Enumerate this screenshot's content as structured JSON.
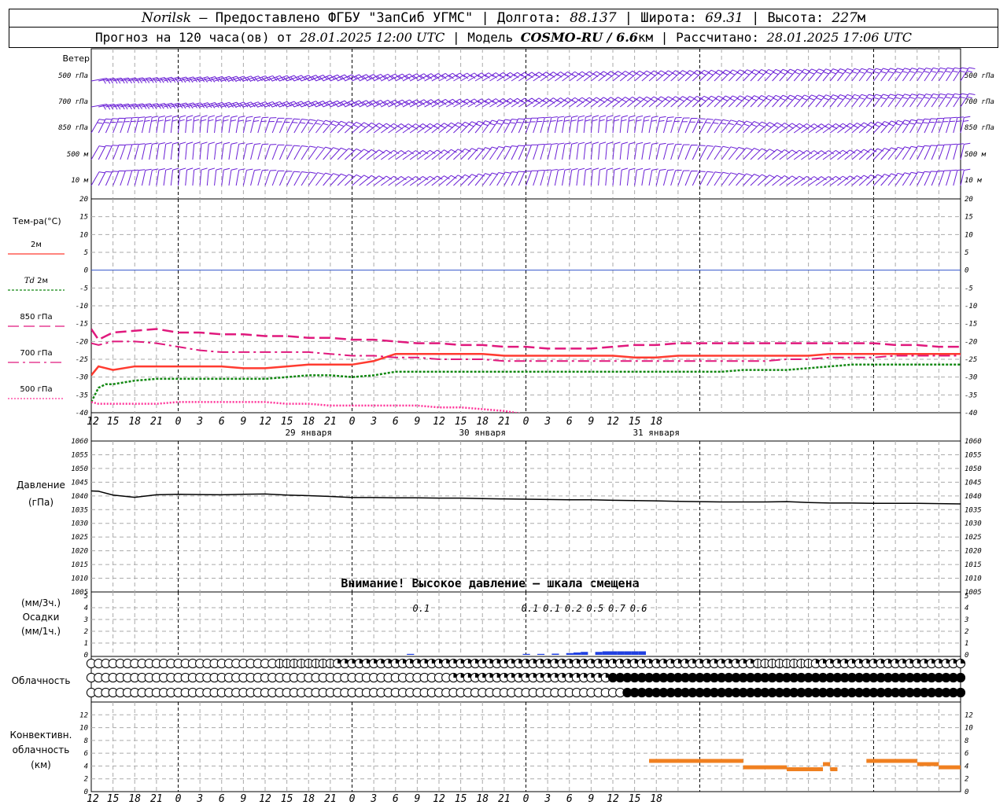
{
  "header": {
    "station": "Norilsk",
    "dash": " – ",
    "provided": "Предоставлено ФГБУ \"ЗапСиб УГМС\" | Долгота: ",
    "lon": "88.137",
    "sep1": " | Широта: ",
    "lat": "69.31",
    "sep2": " | Высота: ",
    "alt": "227",
    "alt_unit": "м",
    "forecast_prefix": "Прогноз на 120 часа(ов) от ",
    "issued": "28.01.2025 12:00 UTC",
    "model_prefix": "  | Модель ",
    "model": "COSMO-RU / 6.6",
    "model_unit": "км",
    "calc_prefix": " | Рассчитано: ",
    "calculated": "28.01.2025 17:06 UTC"
  },
  "labels": {
    "wind": "Ветер",
    "temp": "Тем-ра(°С)",
    "t2m": "2м",
    "td_italic": "Td",
    "td_rest": " 2м",
    "t850": "850 гПа",
    "t700": "700 гПа",
    "t500": "500 гПа",
    "pressure": "Давление",
    "pressure_unit": "(гПа)",
    "precip_unit1": "(мм/3ч.)",
    "precip_title": "Осадки",
    "precip_unit2": "(мм/1ч.)",
    "cloud": "Облачность",
    "conv1": "Конвективн.",
    "conv2": "облачность",
    "conv3": "(км)",
    "warning": "Внимание! Высокое давление – шкала смещена"
  },
  "colors": {
    "t2m": "#ff3b30",
    "td2m": "#118811",
    "t850": "#e0197d",
    "t700": "#e0197d",
    "t500": "#ff3399",
    "wind": "#6a1fd6",
    "pressure": "#000000",
    "precip": "#2040e0",
    "conv": "#f08020",
    "zero": "#3355cc",
    "grid": "#999999"
  },
  "chart_data": [
    {
      "type": "barbs",
      "levels": [
        "500 гПа",
        "700 гПа",
        "850 гПа",
        "500 м",
        "10 м"
      ],
      "note": "wind barbs per level, hourly"
    },
    {
      "type": "line",
      "ylim": [
        -40,
        20
      ],
      "yticks": [
        20,
        15,
        10,
        5,
        0,
        -5,
        -10,
        -15,
        -20,
        -25,
        -30,
        -35,
        -40
      ],
      "x_hours": [
        0,
        1,
        2,
        3,
        6,
        9,
        12,
        15,
        18,
        21,
        24,
        27,
        30,
        33,
        36,
        39,
        42,
        45,
        48,
        51,
        54,
        57,
        60,
        63,
        66,
        69,
        72,
        75,
        78,
        81,
        84,
        87,
        90,
        93,
        96,
        99,
        102,
        105,
        108,
        111,
        114,
        117,
        120
      ],
      "series": [
        {
          "name": "2м",
          "values": [
            -29.5,
            -27,
            -27.5,
            -28,
            -27,
            -27,
            -27,
            -27,
            -27,
            -27.5,
            -27.5,
            -27,
            -26.5,
            -26.5,
            -26.5,
            -25.5,
            -23.5,
            -23.5,
            -23.5,
            -23.5,
            -23.5,
            -24,
            -24,
            -24,
            -24,
            -24,
            -24,
            -24.5,
            -24.5,
            -24,
            -24,
            -24,
            -24,
            -24,
            -24,
            -24,
            -23.5,
            -23.5,
            -23.5,
            -23.5,
            -23.5,
            -23.5,
            -23.5
          ]
        },
        {
          "name": "Td 2м",
          "values": [
            -37,
            -33,
            -32,
            -32,
            -31,
            -30.5,
            -30.5,
            -30.5,
            -30.5,
            -30.5,
            -30.5,
            -30,
            -29.5,
            -29.5,
            -30,
            -29.5,
            -28.5,
            -28.5,
            -28.5,
            -28.5,
            -28.5,
            -28.5,
            -28.5,
            -28.5,
            -28.5,
            -28.5,
            -28.5,
            -28.5,
            -28.5,
            -28.5,
            -28.5,
            -28.5,
            -28,
            -28,
            -28,
            -27.5,
            -27,
            -26.5,
            -26.5,
            -26.5,
            -26.5,
            -26.5,
            -26.5
          ]
        },
        {
          "name": "850 гПа",
          "values": [
            -16.5,
            -19.5,
            -18.5,
            -17.5,
            -17,
            -16.5,
            -17.5,
            -17.5,
            -18,
            -18,
            -18.5,
            -18.5,
            -19,
            -19,
            -19.5,
            -19.5,
            -20,
            -20.5,
            -20.5,
            -21,
            -21,
            -21.5,
            -21.5,
            -22,
            -22,
            -22,
            -21.5,
            -21,
            -21,
            -20.5,
            -20.5,
            -20.5,
            -20.5,
            -20.5,
            -20.5,
            -20.5,
            -20.5,
            -20.5,
            -20.5,
            -21,
            -21,
            -21.5,
            -21.5
          ]
        },
        {
          "name": "700 гПа",
          "values": [
            -20.5,
            -21,
            -20.5,
            -20,
            -20,
            -20.5,
            -21.5,
            -22.5,
            -23,
            -23,
            -23,
            -23,
            -23,
            -23.5,
            -24,
            -24,
            -24.5,
            -24.5,
            -25,
            -25,
            -25,
            -25.5,
            -25.5,
            -25.5,
            -25.5,
            -25.5,
            -25.5,
            -25.5,
            -25.5,
            -25.5,
            -25.5,
            -25.5,
            -25.5,
            -25.5,
            -25,
            -25,
            -24.5,
            -24.5,
            -24.5,
            -24,
            -24,
            -24,
            -24
          ]
        },
        {
          "name": "500 гПа",
          "values": [
            -37,
            -37.5,
            -37.5,
            -37.5,
            -37.5,
            -37.5,
            -37,
            -37,
            -37,
            -37,
            -37,
            -37.5,
            -37.5,
            -38,
            -38,
            -38,
            -38,
            -38,
            -38.5,
            -38.5,
            -39,
            -39.5,
            -40.5,
            -41,
            -41,
            -41,
            -41,
            -41,
            -41,
            -41,
            -41,
            -41,
            -41,
            -41,
            -41,
            -41,
            -41,
            -41,
            -41,
            -41,
            -41,
            -41,
            -41
          ]
        }
      ]
    },
    {
      "type": "line",
      "ylim": [
        1005,
        1060
      ],
      "yticks": [
        1060,
        1055,
        1050,
        1045,
        1040,
        1035,
        1030,
        1025,
        1020,
        1015,
        1010,
        1005
      ],
      "x_hours": [
        0,
        1,
        3,
        6,
        9,
        12,
        15,
        18,
        21,
        24,
        27,
        30,
        33,
        36,
        39,
        42,
        45,
        48,
        51,
        54,
        57,
        60,
        63,
        66,
        69,
        72,
        75,
        78,
        81,
        84,
        87,
        90,
        93,
        96,
        99,
        102,
        105,
        108,
        111,
        114,
        117,
        120
      ],
      "series": [
        {
          "name": "Давление",
          "values": [
            1041.8,
            1041.7,
            1040.3,
            1039.5,
            1040.4,
            1040.6,
            1040.5,
            1040.4,
            1040.6,
            1040.7,
            1040.3,
            1040.1,
            1039.8,
            1039.4,
            1039.4,
            1039.3,
            1039.3,
            1039.2,
            1039.2,
            1039.0,
            1038.9,
            1038.8,
            1038.7,
            1038.6,
            1038.6,
            1038.4,
            1038.3,
            1038.2,
            1038.0,
            1037.9,
            1037.8,
            1037.8,
            1037.8,
            1037.9,
            1037.6,
            1037.4,
            1037.4,
            1037.3,
            1037.3,
            1037.3,
            1037.2,
            1037.1
          ]
        }
      ]
    },
    {
      "type": "bar",
      "ylim": [
        0,
        5
      ],
      "yticks": [
        5,
        4,
        3,
        2,
        1,
        0
      ],
      "precip_3h_labels": [
        {
          "hour": 45,
          "label": "0.1"
        },
        {
          "hour": 60,
          "label": "0.1"
        },
        {
          "hour": 63,
          "label": "0.1"
        },
        {
          "hour": 66,
          "label": "0.2"
        },
        {
          "hour": 69,
          "label": "0.5"
        },
        {
          "hour": 72,
          "label": "0.7"
        },
        {
          "hour": 75,
          "label": "0.6"
        }
      ],
      "hourly": [
        [
          44,
          0.05
        ],
        [
          60,
          0.05
        ],
        [
          62,
          0.05
        ],
        [
          64,
          0.1
        ],
        [
          66,
          0.15
        ],
        [
          67,
          0.2
        ],
        [
          68,
          0.25
        ],
        [
          70,
          0.25
        ],
        [
          71,
          0.3
        ],
        [
          72,
          0.3
        ],
        [
          73,
          0.3
        ],
        [
          74,
          0.3
        ],
        [
          75,
          0.3
        ],
        [
          76,
          0.3
        ]
      ]
    },
    {
      "type": "bar",
      "ylim": [
        0,
        14
      ],
      "yticks": [
        12,
        10,
        8,
        6,
        4,
        2,
        0
      ],
      "segments": [
        {
          "from": 77,
          "to": 90,
          "value": 4.8
        },
        {
          "from": 90,
          "to": 96,
          "value": 3.8
        },
        {
          "from": 96,
          "to": 101,
          "value": 3.5
        },
        {
          "from": 101,
          "to": 102,
          "value": 4.3
        },
        {
          "from": 102,
          "to": 103,
          "value": 3.5
        },
        {
          "from": 107,
          "to": 114,
          "value": 4.8
        },
        {
          "from": 114,
          "to": 117,
          "value": 4.3
        },
        {
          "from": 117,
          "to": 120,
          "value": 3.8
        }
      ]
    }
  ],
  "x_axis": {
    "ticks": [
      "12",
      "15",
      "18",
      "21",
      "0",
      "3",
      "6",
      "9",
      "12",
      "15",
      "18",
      "21",
      "0",
      "3",
      "6",
      "9",
      "12",
      "15",
      "18",
      "21",
      "0",
      "3",
      "6",
      "9",
      "12",
      "15",
      "18"
    ],
    "dates": [
      {
        "hour": 30,
        "label": "29 января"
      },
      {
        "hour": 54,
        "label": "30 января"
      },
      {
        "hour": 78,
        "label": "31 января"
      }
    ]
  }
}
